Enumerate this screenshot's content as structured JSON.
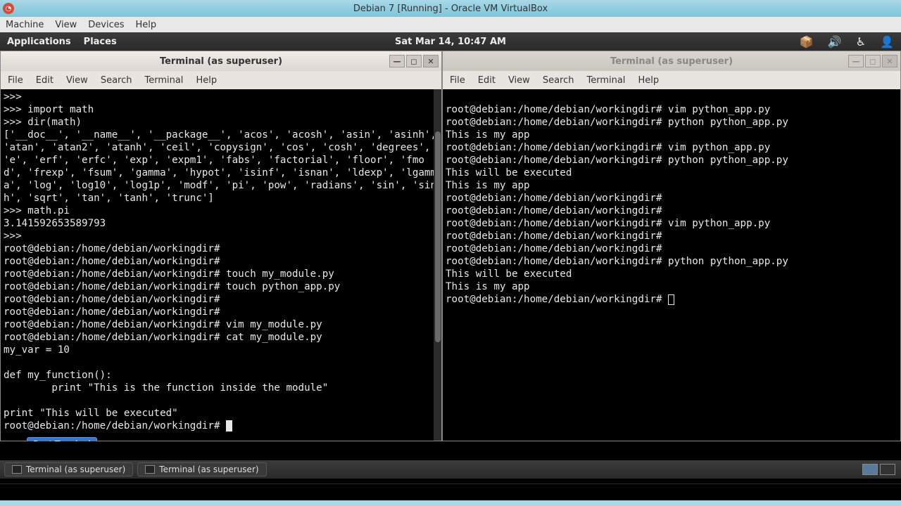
{
  "vbox": {
    "title": "Debian 7 [Running] - Oracle VM VirtualBox",
    "menu": [
      "Machine",
      "View",
      "Devices",
      "Help"
    ]
  },
  "gnome": {
    "apps": "Applications",
    "places": "Places",
    "clock": "Sat Mar 14, 10:47 AM"
  },
  "icons": {
    "updates": "updates-icon",
    "volume": "volume-icon",
    "a11y": "accessibility-icon",
    "user": "user-icon"
  },
  "term_left": {
    "title": "Terminal (as superuser)",
    "menu": [
      "File",
      "Edit",
      "View",
      "Search",
      "Terminal",
      "Help"
    ],
    "content": ">>>\n>>> import math\n>>> dir(math)\n['__doc__', '__name__', '__package__', 'acos', 'acosh', 'asin', 'asinh', 'atan', 'atan2', 'atanh', 'ceil', 'copysign', 'cos', 'cosh', 'degrees', 'e', 'erf', 'erfc', 'exp', 'expm1', 'fabs', 'factorial', 'floor', 'fmod', 'frexp', 'fsum', 'gamma', 'hypot', 'isinf', 'isnan', 'ldexp', 'lgamma', 'log', 'log10', 'log1p', 'modf', 'pi', 'pow', 'radians', 'sin', 'sinh', 'sqrt', 'tan', 'tanh', 'trunc']\n>>> math.pi\n3.141592653589793\n>>>\nroot@debian:/home/debian/workingdir#\nroot@debian:/home/debian/workingdir#\nroot@debian:/home/debian/workingdir# touch my_module.py\nroot@debian:/home/debian/workingdir# touch python_app.py\nroot@debian:/home/debian/workingdir#\nroot@debian:/home/debian/workingdir#\nroot@debian:/home/debian/workingdir# vim my_module.py\nroot@debian:/home/debian/workingdir# cat my_module.py\nmy_var = 10\n\ndef my_function():\n        print \"This is the function inside the module\"\n\nprint \"This will be executed\"\nroot@debian:/home/debian/workingdir# "
  },
  "term_right": {
    "title": "Terminal (as superuser)",
    "menu": [
      "File",
      "Edit",
      "View",
      "Search",
      "Terminal",
      "Help"
    ],
    "content": "\nroot@debian:/home/debian/workingdir# vim python_app.py\nroot@debian:/home/debian/workingdir# python python_app.py\nThis is my app\nroot@debian:/home/debian/workingdir# vim python_app.py\nroot@debian:/home/debian/workingdir# python python_app.py\nThis will be executed\nThis is my app\nroot@debian:/home/debian/workingdir#\nroot@debian:/home/debian/workingdir#\nroot@debian:/home/debian/workingdir# vim python_app.py\nroot@debian:/home/debian/workingdir#\nroot@debian:/home/debian/workingdir#\nroot@debian:/home/debian/workingdir# python python_app.py\nThis will be executed\nThis is my app\nroot@debian:/home/debian/workingdir# "
  },
  "tooltip": "Root Terminal",
  "taskbar": {
    "item1": "Terminal (as superuser)",
    "item2": "Terminal (as superuser)"
  }
}
